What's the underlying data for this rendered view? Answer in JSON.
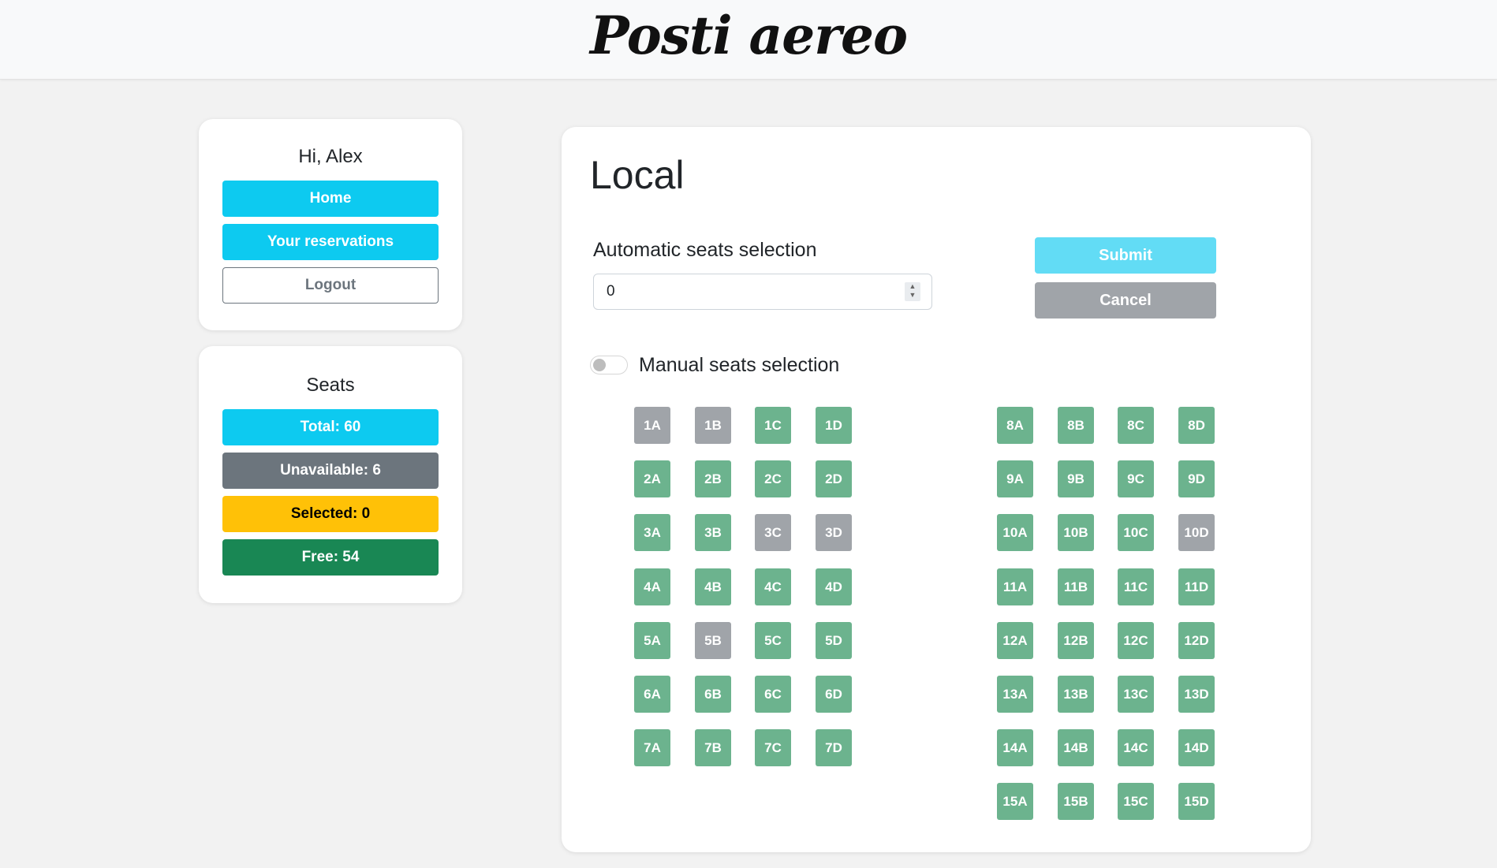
{
  "brand": "Posti aereo",
  "user_panel": {
    "greeting": "Hi, Alex",
    "home_label": "Home",
    "reservations_label": "Your reservations",
    "logout_label": "Logout"
  },
  "seats_panel": {
    "title": "Seats",
    "total": "Total: 60",
    "unavailable": "Unavailable: 6",
    "selected": "Selected: 0",
    "free": "Free: 54"
  },
  "main": {
    "title": "Local",
    "auto_label": "Automatic seats selection",
    "auto_value": "0",
    "submit_label": "Submit",
    "cancel_label": "Cancel",
    "manual_label": "Manual seats selection",
    "manual_enabled": false
  },
  "seat_map": {
    "left_block": [
      [
        {
          "id": "1A",
          "status": "unavailable"
        },
        {
          "id": "1B",
          "status": "unavailable"
        },
        {
          "id": "1C",
          "status": "free"
        },
        {
          "id": "1D",
          "status": "free"
        }
      ],
      [
        {
          "id": "2A",
          "status": "free"
        },
        {
          "id": "2B",
          "status": "free"
        },
        {
          "id": "2C",
          "status": "free"
        },
        {
          "id": "2D",
          "status": "free"
        }
      ],
      [
        {
          "id": "3A",
          "status": "free"
        },
        {
          "id": "3B",
          "status": "free"
        },
        {
          "id": "3C",
          "status": "unavailable"
        },
        {
          "id": "3D",
          "status": "unavailable"
        }
      ],
      [
        {
          "id": "4A",
          "status": "free"
        },
        {
          "id": "4B",
          "status": "free"
        },
        {
          "id": "4C",
          "status": "free"
        },
        {
          "id": "4D",
          "status": "free"
        }
      ],
      [
        {
          "id": "5A",
          "status": "free"
        },
        {
          "id": "5B",
          "status": "unavailable"
        },
        {
          "id": "5C",
          "status": "free"
        },
        {
          "id": "5D",
          "status": "free"
        }
      ],
      [
        {
          "id": "6A",
          "status": "free"
        },
        {
          "id": "6B",
          "status": "free"
        },
        {
          "id": "6C",
          "status": "free"
        },
        {
          "id": "6D",
          "status": "free"
        }
      ],
      [
        {
          "id": "7A",
          "status": "free"
        },
        {
          "id": "7B",
          "status": "free"
        },
        {
          "id": "7C",
          "status": "free"
        },
        {
          "id": "7D",
          "status": "free"
        }
      ]
    ],
    "right_block": [
      [
        {
          "id": "8A",
          "status": "free"
        },
        {
          "id": "8B",
          "status": "free"
        },
        {
          "id": "8C",
          "status": "free"
        },
        {
          "id": "8D",
          "status": "free"
        }
      ],
      [
        {
          "id": "9A",
          "status": "free"
        },
        {
          "id": "9B",
          "status": "free"
        },
        {
          "id": "9C",
          "status": "free"
        },
        {
          "id": "9D",
          "status": "free"
        }
      ],
      [
        {
          "id": "10A",
          "status": "free"
        },
        {
          "id": "10B",
          "status": "free"
        },
        {
          "id": "10C",
          "status": "free"
        },
        {
          "id": "10D",
          "status": "unavailable"
        }
      ],
      [
        {
          "id": "11A",
          "status": "free"
        },
        {
          "id": "11B",
          "status": "free"
        },
        {
          "id": "11C",
          "status": "free"
        },
        {
          "id": "11D",
          "status": "free"
        }
      ],
      [
        {
          "id": "12A",
          "status": "free"
        },
        {
          "id": "12B",
          "status": "free"
        },
        {
          "id": "12C",
          "status": "free"
        },
        {
          "id": "12D",
          "status": "free"
        }
      ],
      [
        {
          "id": "13A",
          "status": "free"
        },
        {
          "id": "13B",
          "status": "free"
        },
        {
          "id": "13C",
          "status": "free"
        },
        {
          "id": "13D",
          "status": "free"
        }
      ],
      [
        {
          "id": "14A",
          "status": "free"
        },
        {
          "id": "14B",
          "status": "free"
        },
        {
          "id": "14C",
          "status": "free"
        },
        {
          "id": "14D",
          "status": "free"
        }
      ],
      [
        {
          "id": "15A",
          "status": "free"
        },
        {
          "id": "15B",
          "status": "free"
        },
        {
          "id": "15C",
          "status": "free"
        },
        {
          "id": "15D",
          "status": "free"
        }
      ]
    ]
  },
  "colors": {
    "primary": "#0dcaf0",
    "secondary": "#6c757d",
    "warning": "#ffc107",
    "success": "#198754",
    "seat_free": "#6cb38e",
    "seat_unavailable": "#a0a4a9"
  }
}
